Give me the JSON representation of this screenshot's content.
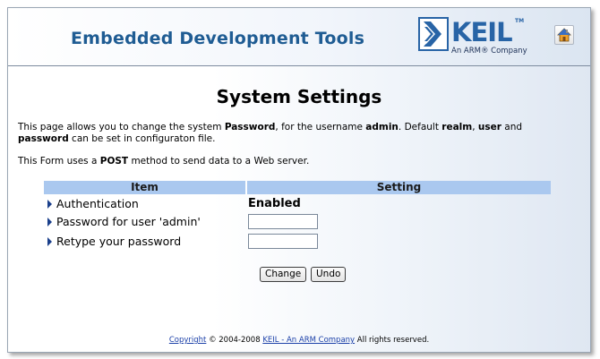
{
  "header": {
    "title": "Embedded Development Tools",
    "logo_text": "KEIL",
    "logo_tm": "TM",
    "logo_subtitle": "An ARM® Company",
    "home_icon": "home-icon"
  },
  "page": {
    "title": "System Settings",
    "intro": {
      "t1": "This page allows you to change the system ",
      "b1": "Password",
      "t2": ", for the username ",
      "b2": "admin",
      "t3": ". Default ",
      "b3": "realm",
      "t4": ", ",
      "b4": "user",
      "t5": " and",
      "b5": "password",
      "t6": " can be set in configuraton file."
    },
    "form_note": {
      "t1": "This Form uses a ",
      "b1": "POST",
      "t2": " method to send data to a Web server."
    }
  },
  "table": {
    "col_item": "Item",
    "col_setting": "Setting",
    "rows": [
      {
        "label": "Authentication",
        "value": "Enabled"
      },
      {
        "label": "Password for user 'admin'",
        "value": ""
      },
      {
        "label": "Retype your password",
        "value": ""
      }
    ]
  },
  "buttons": {
    "change": "Change",
    "undo": "Undo"
  },
  "footer": {
    "copyright_link": "Copyright",
    "text1": " © 2004-2008 ",
    "company_link": "KEIL - An ARM Company",
    "text2": " All rights reserved."
  },
  "colors": {
    "title_blue": "#1f5c93",
    "logo_blue": "#2864a6",
    "table_header": "#aac8ef",
    "bullet": "#1a3f8b"
  }
}
